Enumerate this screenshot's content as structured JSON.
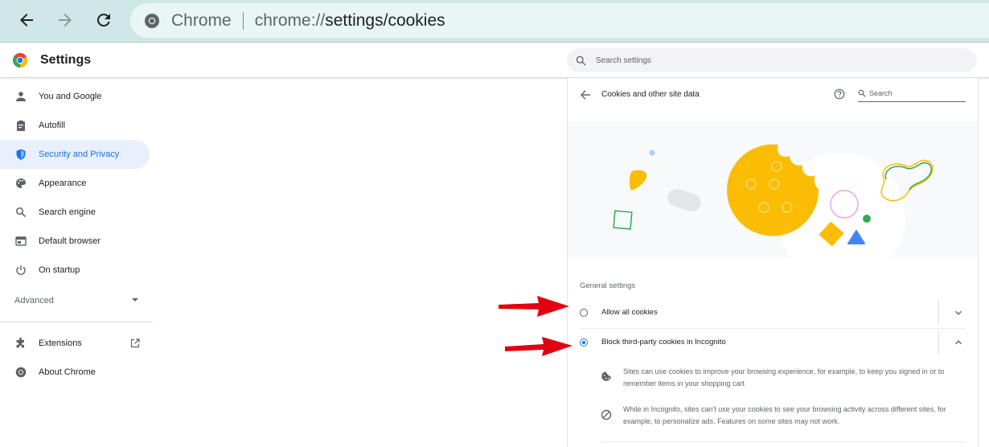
{
  "browser": {
    "omnibox_label": "Chrome",
    "url_prefix": "chrome://",
    "url_path": "settings/cookies"
  },
  "header": {
    "title": "Settings",
    "search_placeholder": "Search settings"
  },
  "sidebar": {
    "items": [
      {
        "label": "You and Google",
        "icon": "person-icon"
      },
      {
        "label": "Autofill",
        "icon": "clipboard-icon"
      },
      {
        "label": "Security and Privacy",
        "icon": "shield-icon",
        "active": true
      },
      {
        "label": "Appearance",
        "icon": "palette-icon"
      },
      {
        "label": "Search engine",
        "icon": "search-icon"
      },
      {
        "label": "Default browser",
        "icon": "browser-window-icon"
      },
      {
        "label": "On startup",
        "icon": "power-icon"
      }
    ],
    "advanced_label": "Advanced",
    "bottom_items": [
      {
        "label": "Extensions",
        "icon": "puzzle-icon"
      },
      {
        "label": "About Chrome",
        "icon": "chrome-icon"
      }
    ]
  },
  "cookies_page": {
    "title": "Cookies and other site data",
    "search_placeholder": "Search",
    "section_label": "General settings",
    "options": [
      {
        "label": "Allow all cookies",
        "selected": false,
        "expanded": false
      },
      {
        "label": "Block third-party cookies in Incognito",
        "selected": true,
        "expanded": true
      }
    ],
    "details": [
      {
        "icon": "cookie-icon",
        "text": "Sites can use cookies to improve your browsing experience, for example, to keep you signed in or to remember items in your shopping cart"
      },
      {
        "icon": "block-icon",
        "text": "While in Incognito, sites can't use your cookies to see your browsing activity across different sites, for example, to personalize ads. Features on some sites may not work."
      }
    ]
  },
  "colors": {
    "accent": "#1a73e8",
    "annotation_arrow": "#e0000f",
    "topbar": "#cfe7e7"
  }
}
